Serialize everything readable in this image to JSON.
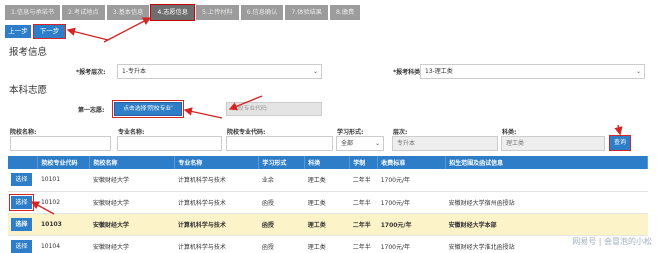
{
  "steps": [
    {
      "label": "1.信息与承诺书",
      "active": false
    },
    {
      "label": "2.考试地点",
      "active": false
    },
    {
      "label": "3.基本信息",
      "active": false
    },
    {
      "label": "4.志愿信息",
      "active": true
    },
    {
      "label": "5.上传材料",
      "active": false
    },
    {
      "label": "6.信息确认",
      "active": false
    },
    {
      "label": "7.体验结果",
      "active": false
    },
    {
      "label": "8.缴费",
      "active": false
    }
  ],
  "nav": {
    "prev": "上一步",
    "next": "下一步"
  },
  "sections": {
    "apply_info": "报考信息",
    "undergrad_choice": "本科志愿"
  },
  "form": {
    "level_label": "*报考层次:",
    "level_value": "1-专升本",
    "subject_label": "*报考科类:",
    "subject_value": "13-理工类",
    "first_choice_label": "第一志愿:",
    "choose_school_btn": "点击选择'院校专业'",
    "major_code_placeholder": "院校专业代码"
  },
  "search": {
    "school_label": "院校名称:",
    "major_label": "专业名称:",
    "code_label": "院校专业代码:",
    "mode_label": "学习形式:",
    "mode_value": "全部",
    "level_label": "层次:",
    "level_value": "专升本",
    "subject_label": "科类:",
    "subject_value": "理工类",
    "query_btn": "查询"
  },
  "table": {
    "headers": [
      "",
      "院校专业代码",
      "院校名称",
      "专业名称",
      "学习形式",
      "科类",
      "学制",
      "收费标准",
      "招生范围及函试信息"
    ],
    "select_label": "选择",
    "rows": [
      {
        "code": "10101",
        "school": "安徽财经大学",
        "major": "计算机科学与技术",
        "mode": "业余",
        "subject": "理工类",
        "years": "二年半",
        "fee": "1700元/年",
        "scope": "",
        "highlight": false,
        "marked": false
      },
      {
        "code": "10102",
        "school": "安徽财经大学",
        "major": "计算机科学与技术",
        "mode": "函授",
        "subject": "理工类",
        "years": "二年半",
        "fee": "1700元/年",
        "scope": "安徽财经大学宿州函授站",
        "highlight": false,
        "marked": true
      },
      {
        "code": "10103",
        "school": "安徽财经大学",
        "major": "计算机科学与技术",
        "mode": "函授",
        "subject": "理工类",
        "years": "二年半",
        "fee": "1700元/年",
        "scope": "安徽财经大学本部",
        "highlight": true,
        "marked": false
      },
      {
        "code": "10104",
        "school": "安徽财经大学",
        "major": "计算机科学与技术",
        "mode": "函授",
        "subject": "理工类",
        "years": "二年半",
        "fee": "1700元/年",
        "scope": "安徽财经大学淮北函授站",
        "highlight": false,
        "marked": false
      }
    ]
  },
  "watermark": "网易号 | 会冒泡的小松",
  "colors": {
    "primary": "#2d7dc8",
    "annotation": "#d62424",
    "highlight_row": "#fdf3c8"
  }
}
